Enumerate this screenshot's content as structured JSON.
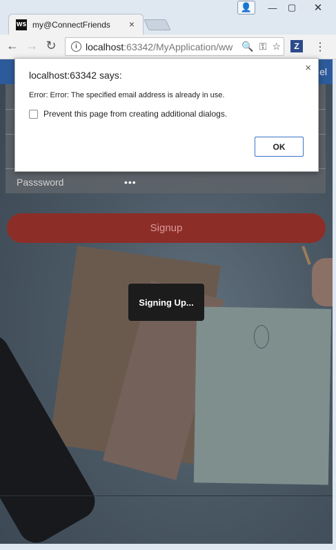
{
  "window": {
    "controls": {
      "user": "👤",
      "minimize": "—",
      "maximize": "▢",
      "close": "✕"
    }
  },
  "tab": {
    "favicon_text": "WS",
    "title": "my@ConnectFriends",
    "close": "×"
  },
  "toolbar": {
    "back": "←",
    "forward": "→",
    "reload": "↻",
    "url_host": "localhost",
    "url_rest": ":63342/MyApplication/ww",
    "zoom": "🔍",
    "key": "⚿",
    "star": "☆",
    "extension": "Z",
    "menu": "⋮"
  },
  "page": {
    "header_fragment": "el",
    "password_label": "Passsword",
    "password_value": "•••",
    "signup_label": "Signup",
    "toast": "Signing Up..."
  },
  "dialog": {
    "title": "localhost:63342 says:",
    "message": "Error: Error: The specified email address is already in use.",
    "checkbox_label": "Prevent this page from creating additional dialogs.",
    "ok_label": "OK",
    "close": "×"
  },
  "colors": {
    "header": "#2d5a9a",
    "signup": "#8d2d28",
    "ok_border": "#3b73c7"
  }
}
